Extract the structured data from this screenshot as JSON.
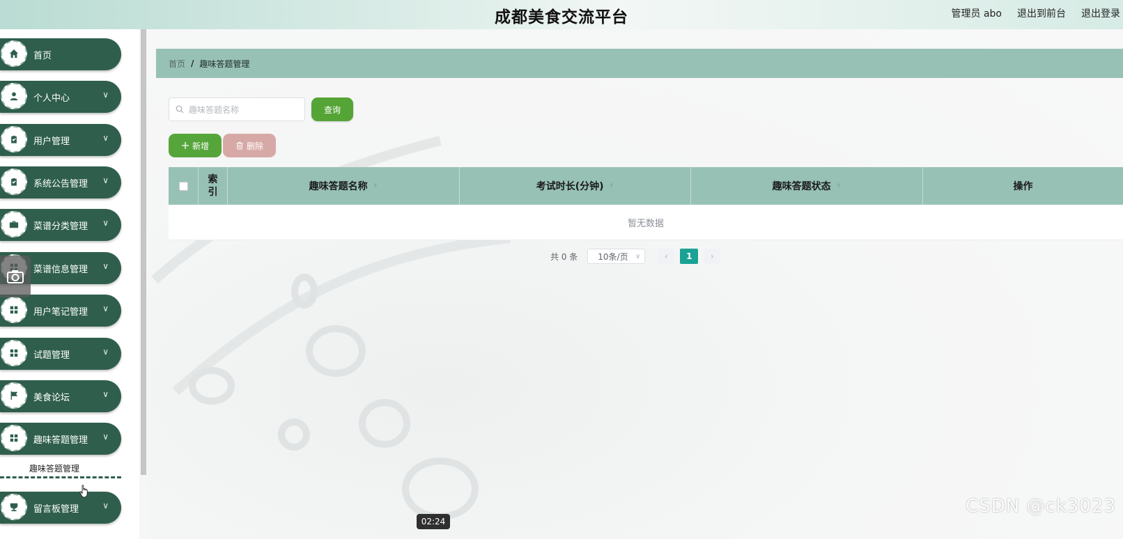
{
  "header": {
    "title": "成都美食交流平台",
    "user_label": "管理员 abo",
    "to_front_label": "退出到前台",
    "logout_label": "退出登录"
  },
  "sidebar": {
    "items": [
      {
        "label": "首页",
        "icon": "home-icon"
      },
      {
        "label": "个人中心",
        "icon": "user-icon"
      },
      {
        "label": "用户管理",
        "icon": "clipboard-icon"
      },
      {
        "label": "系统公告管理",
        "icon": "clipboard-icon"
      },
      {
        "label": "菜谱分类管理",
        "icon": "briefcase-icon"
      },
      {
        "label": "菜谱信息管理",
        "icon": "camera-icon"
      },
      {
        "label": "用户笔记管理",
        "icon": "grid-icon"
      },
      {
        "label": "试题管理",
        "icon": "grid-icon"
      },
      {
        "label": "美食论坛",
        "icon": "flag-icon"
      },
      {
        "label": "趣味答题管理",
        "icon": "grid-icon"
      },
      {
        "label": "留言板管理",
        "icon": "cup-icon"
      }
    ],
    "submenu_label": "趣味答题管理"
  },
  "breadcrumb": {
    "home": "首页",
    "separator": "/",
    "current": "趣味答题管理"
  },
  "search": {
    "placeholder": "趣味答题名称",
    "query_button": "查询"
  },
  "actions": {
    "add_label": "新增",
    "delete_label": "删除"
  },
  "table": {
    "columns": [
      "索引",
      "趣味答题名称",
      "考试时长(分钟)",
      "趣味答题状态",
      "操作"
    ],
    "empty_text": "暂无数据"
  },
  "pagination": {
    "total_text": "共 0 条",
    "page_size": "10条/页",
    "current_page": "1"
  },
  "overlay": {
    "watermark": "CSDN @ck3023",
    "timecode": "02:24"
  },
  "colors": {
    "sidebar_item": "#2f5f4c",
    "breadcrumb_bg": "#98c1b6",
    "primary_green": "#55a436",
    "delete_pink": "#d7a9a6",
    "page_active": "#1aa294"
  }
}
